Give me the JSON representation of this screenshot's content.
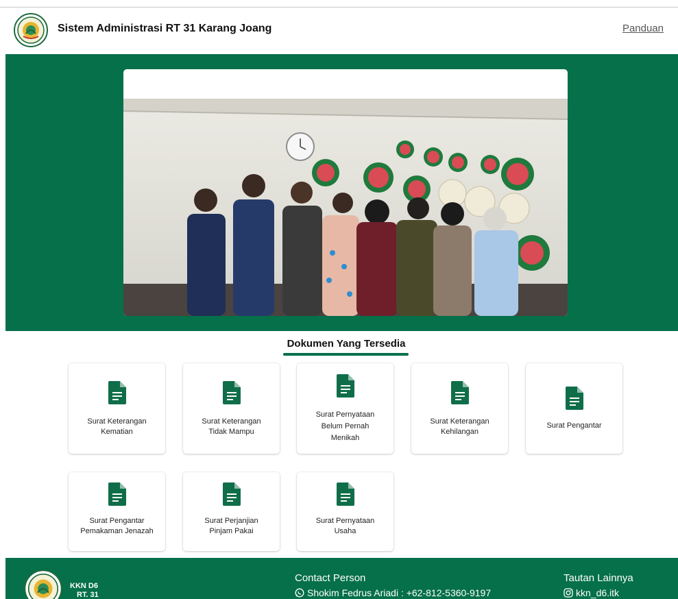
{
  "header": {
    "title": "Sistem Administrasi RT 31 Karang Joang",
    "guide_link": "Panduan"
  },
  "hero": {
    "image": "group-photo"
  },
  "documents": {
    "heading": "Dokumen Yang Tersedia",
    "items": [
      {
        "lines": [
          "Surat Keterangan",
          "Kematian"
        ]
      },
      {
        "lines": [
          "Surat Keterangan",
          "Tidak Mampu"
        ]
      },
      {
        "lines": [
          "Surat Pernyataan",
          "Belum Pernah",
          "Menikah"
        ]
      },
      {
        "lines": [
          "Surat Keterangan",
          "Kehilangan"
        ]
      },
      {
        "lines": [
          "Surat Pengantar"
        ]
      },
      {
        "lines": [
          "Surat Pengantar",
          "Pemakaman Jenazah"
        ]
      },
      {
        "lines": [
          "Surat Perjanjian",
          "Pinjam Pakai"
        ]
      },
      {
        "lines": [
          "Surat Pernyataan",
          "Usaha"
        ]
      }
    ]
  },
  "footer": {
    "org_line1": "KKN D6",
    "org_line2": "RT. 31",
    "contact_heading": "Contact Person",
    "contact_line": "Shokim Fedrus Ariadi : +62-812-5360-9197",
    "links_heading": "Tautan Lainnya",
    "instagram": "kkn_d6.itk"
  },
  "colors": {
    "primary": "#05704a",
    "icon": "#0f6e49"
  }
}
